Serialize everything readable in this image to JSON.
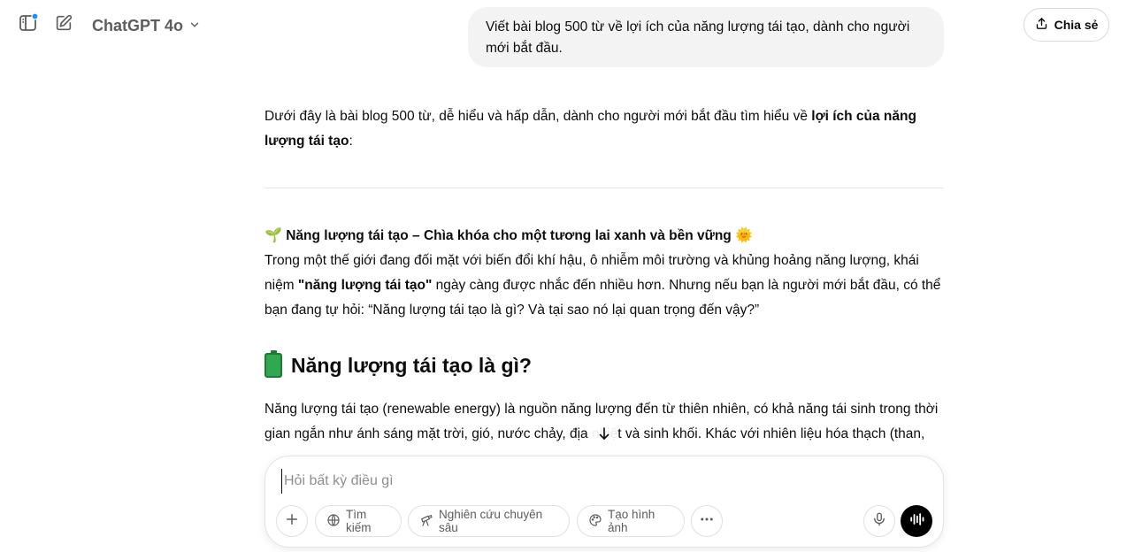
{
  "header": {
    "model_name": "ChatGPT 4o",
    "share_label": "Chia sẻ"
  },
  "user_message": "Viết bài blog 500 từ về lợi ích của năng lượng tái tạo, dành cho người mới bắt đầu.",
  "assistant": {
    "intro_prefix": "Dưới đây là bài blog 500 từ, dễ hiểu và hấp dẫn, dành cho người mới bắt đầu tìm hiểu về ",
    "intro_bold": "lợi ích của năng lượng tái tạo",
    "intro_suffix": ":",
    "title_emoji": "🌱",
    "title": "Năng lượng tái tạo – Chìa khóa cho một tương lai xanh và bền vững",
    "title_end_emoji": "🌞",
    "para1_prefix": "Trong một thế giới đang đối mặt với biến đổi khí hậu, ô nhiễm môi trường và khủng hoảng năng lượng, khái niệm ",
    "para1_bold": "\"năng lượng tái tạo\"",
    "para1_suffix": " ngày càng được nhắc đến nhiều hơn. Nhưng nếu bạn là người mới bắt đầu, có thể bạn đang tự hỏi: “Năng lượng tái tạo là gì? Và tại sao nó lại quan trọng đến vậy?”",
    "heading1": "Năng lượng tái tạo là gì?",
    "para2": "Năng lượng tái tạo (renewable energy) là nguồn năng lượng đến từ thiên nhiên, có khả năng tái sinh trong thời gian ngắn như ánh sáng mặt trời, gió, nước chảy, địa nhiệt và sinh khối. Khác với nhiên liệu hóa thạch (than,"
  },
  "composer": {
    "placeholder": "Hỏi bất kỳ điều gì",
    "search_label": "Tìm kiếm",
    "deep_research_label": "Nghiên cứu chuyên sâu",
    "create_image_label": "Tạo hình ảnh"
  },
  "colors": {
    "notification_dot": "#1a8cff",
    "voice_button": "#000000",
    "user_bubble": "#f3f3f3"
  }
}
